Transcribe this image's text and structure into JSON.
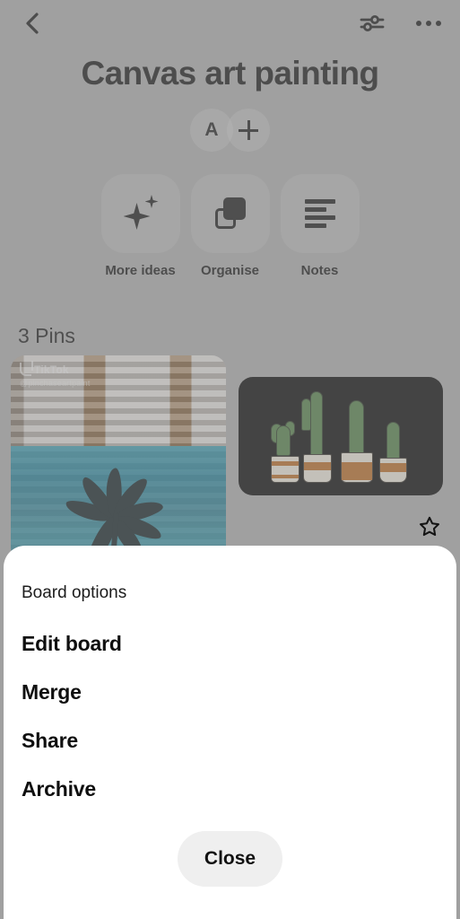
{
  "app": "Pinterest board page with Board options sheet",
  "topbar": {
    "back_icon": "chevron-left-icon",
    "filter_icon": "sliders-icon",
    "overflow_icon": "more-horizontal-icon"
  },
  "board": {
    "title": "Canvas art painting",
    "avatars": [
      {
        "type": "initial",
        "label": "A"
      },
      {
        "type": "add",
        "label": "+"
      }
    ],
    "actions": [
      {
        "id": "more-ideas",
        "label": "More ideas",
        "icon": "sparkle-icon"
      },
      {
        "id": "organise",
        "label": "Organise",
        "icon": "stacked-squares-icon"
      },
      {
        "id": "notes",
        "label": "Notes",
        "icon": "text-lines-icon"
      }
    ],
    "pins_count_label": "3 Pins",
    "pins": [
      {
        "id": "pin-palm-tree-painting",
        "alt": "Palm tree ocean canvas painting video",
        "watermark": "TikTok",
        "handle": "@pinchaseartpaint"
      },
      {
        "id": "pin-cacti-painting",
        "alt": "Four cacti in patterned pots on black canvas"
      }
    ],
    "favourite_icon": "star-outline-icon"
  },
  "sheet": {
    "title": "Board options",
    "items": [
      {
        "id": "edit-board",
        "label": "Edit board"
      },
      {
        "id": "merge",
        "label": "Merge"
      },
      {
        "id": "share",
        "label": "Share"
      },
      {
        "id": "archive",
        "label": "Archive"
      }
    ],
    "close_label": "Close"
  },
  "colors": {
    "page_background": "#a8a8a8",
    "sheet_background": "#ffffff",
    "text_primary": "#111111",
    "close_button_background": "#efefef",
    "pin_black": "#000000",
    "water_blue": "#1f7f98",
    "cactus_green": "#4e7a43",
    "pot_terracotta": "#b5661f"
  }
}
